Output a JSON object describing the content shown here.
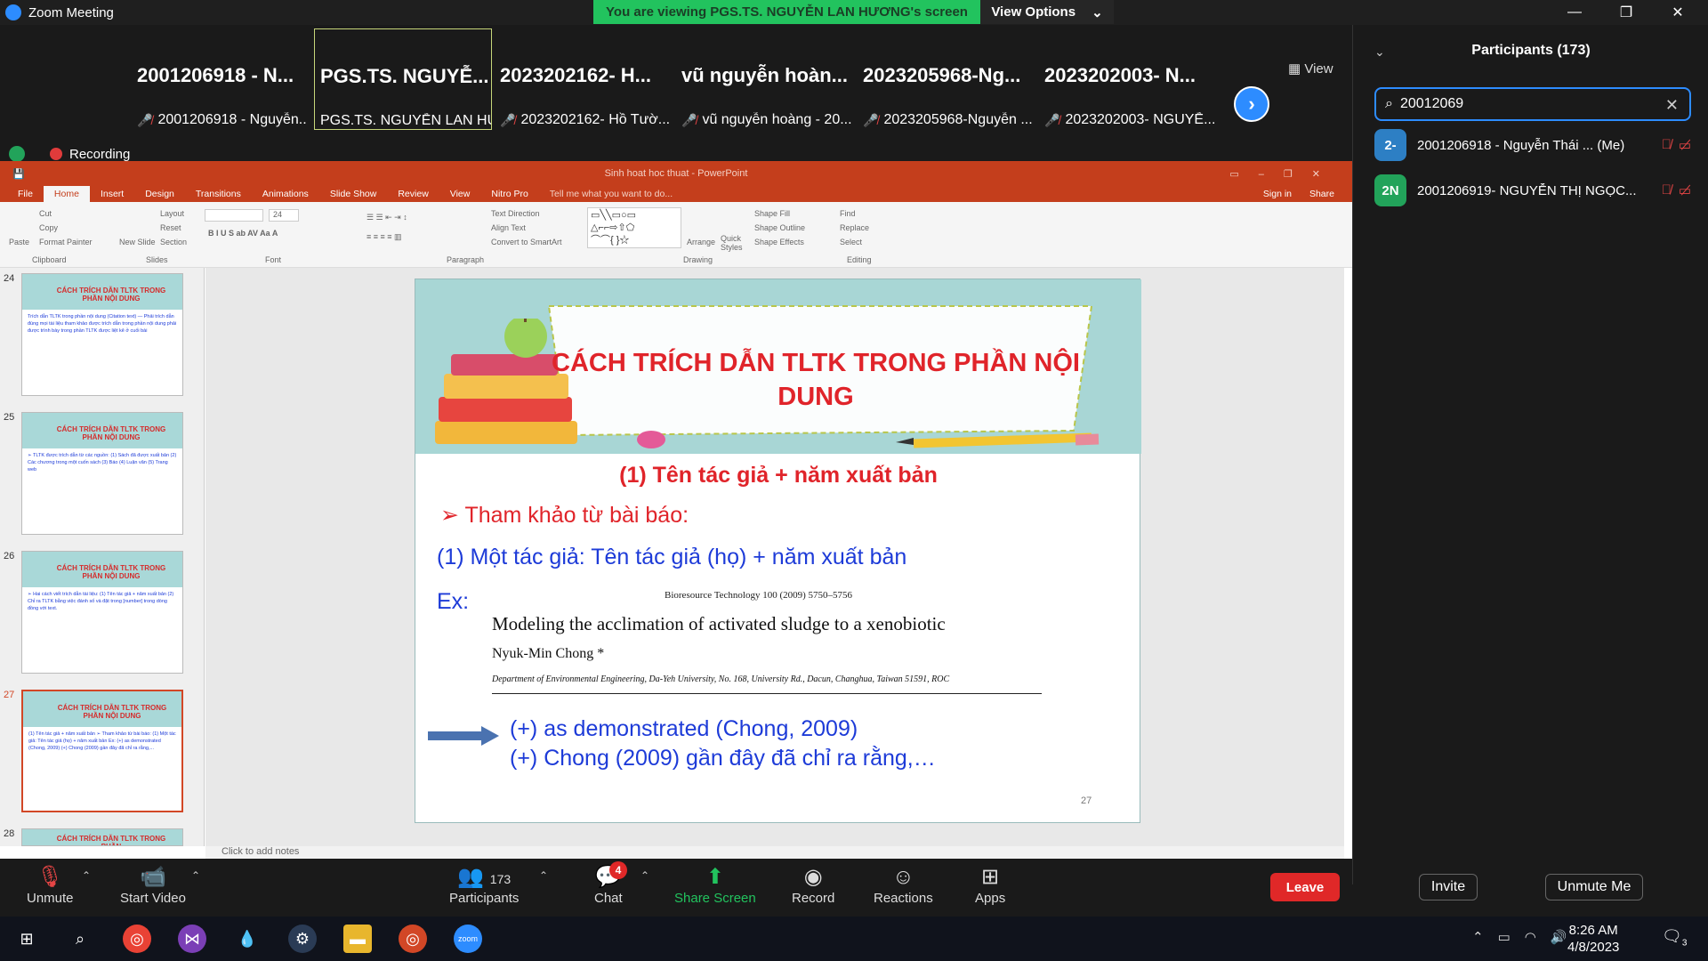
{
  "window": {
    "title": "Zoom Meeting",
    "banner": "You are viewing PGS.TS. NGUYỄN LAN HƯƠNG's screen",
    "view_options": "View Options",
    "view_button": "View"
  },
  "thumbnails": [
    {
      "big": "2001206918 - N...",
      "small": "2001206918 - Nguyễn..."
    },
    {
      "big": "PGS.TS. NGUYỄ...",
      "small": "PGS.TS. NGUYỄN LAN HƯ..."
    },
    {
      "big": "2023202162- H...",
      "small": "2023202162- Hồ Tườ..."
    },
    {
      "big": "vũ nguyễn hoàn...",
      "small": "vũ nguyễn hoàng - 20..."
    },
    {
      "big": "2023205968-Ng...",
      "small": "2023205968-Nguyễn ..."
    },
    {
      "big": "2023202003- N...",
      "small": "2023202003- NGUYỄ..."
    }
  ],
  "recording": "Recording",
  "ppt": {
    "doc_title": "Sinh hoat hoc thuat - PowerPoint",
    "tabs": [
      "File",
      "Home",
      "Insert",
      "Design",
      "Transitions",
      "Animations",
      "Slide Show",
      "Review",
      "View",
      "Nitro Pro",
      "Tell me what you want to do..."
    ],
    "signin": "Sign in",
    "share": "Share",
    "groups": {
      "clipboard": "Clipboard",
      "slides": "Slides",
      "font": "Font",
      "paragraph": "Paragraph",
      "drawing": "Drawing",
      "editing": "Editing"
    },
    "ribbon": {
      "paste": "Paste",
      "cut": "Cut",
      "copy": "Copy",
      "format_painter": "Format Painter",
      "new_slide": "New Slide",
      "layout": "Layout",
      "reset": "Reset",
      "section": "Section",
      "text_direction": "Text Direction",
      "align_text": "Align Text",
      "smartart": "Convert to SmartArt",
      "arrange": "Arrange",
      "quick_styles": "Quick Styles",
      "shape_fill": "Shape Fill",
      "shape_outline": "Shape Outline",
      "shape_effects": "Shape Effects",
      "find": "Find",
      "replace": "Replace",
      "select": "Select",
      "font_size": "24"
    },
    "thumbs": [
      {
        "num": "24",
        "title": "CÁCH TRÍCH DẪN TLTK TRONG PHẦN NỘI DUNG",
        "body": "Trích dẫn TLTK trong phần nội dung (Citation text) — Phải trích dẫn đúng mọi tài liệu tham khảo được trích dẫn trong phần nội dung phải được trình bày trong phần TLTK được liệt kê ở cuối bài"
      },
      {
        "num": "25",
        "title": "CÁCH TRÍCH DẪN TLTK TRONG PHẦN NỘI DUNG",
        "body": "➢ TLTK được trích dẫn từ các nguồn: (1) Sách đã được xuất bản (2) Các chương trong một cuốn sách (3) Báo (4) Luận văn (5) Trang web"
      },
      {
        "num": "26",
        "title": "CÁCH TRÍCH DẪN TLTK TRONG PHẦN NỘI DUNG",
        "body": "➢ Hai cách viết trích dẫn tài liệu: (1) Tên tác giả + năm xuất bản (2) Chỉ ra TLTK bằng việc đánh số và đặt trong [number] trong dòng đồng với text."
      },
      {
        "num": "27",
        "title": "CÁCH TRÍCH DẪN TLTK TRONG PHẦN NỘI DUNG",
        "body": "(1) Tên tác giả + năm xuất bản ➢ Tham khảo từ bài báo: (1) Một tác giả: Tên tác giả (họ) + năm xuất bản Ex: (+) as demonstrated (Chong, 2009) (+) Chong (2009) gần đây đã chỉ ra rằng,..."
      },
      {
        "num": "28",
        "title": "CÁCH TRÍCH DẪN TLTK TRONG PHẦN",
        "body": ""
      }
    ],
    "slide": {
      "title": "CÁCH TRÍCH DẪN TLTK TRONG PHẦN NỘI DUNG",
      "subtitle": "(1) Tên tác giả + năm xuất bản",
      "ref_head": "Tham khảo từ bài báo:",
      "one_author": "(1) Một tác giả: Tên tác giả (họ) + năm xuất bản",
      "ex": "Ex:",
      "journal": "Bioresource Technology 100 (2009) 5750–5756",
      "article": "Modeling the acclimation of activated sludge to a xenobiotic",
      "author": "Nyuk-Min Chong *",
      "affil": "Department of Environmental Engineering, Da-Yeh University, No. 168, University Rd., Dacun, Changhua, Taiwan 51591, ROC",
      "cite1": "(+) as demonstrated (Chong, 2009)",
      "cite2": "(+) Chong (2009) gần đây đã chỉ ra rằng,…",
      "page": "27"
    },
    "notes": "Click to add notes"
  },
  "participants": {
    "title": "Participants (173)",
    "search_value": "20012069",
    "list": [
      {
        "initials": "2-",
        "name": "2001206918 - Nguyễn Thái ... (Me)",
        "color": "#2d7fc4"
      },
      {
        "initials": "2N",
        "name": "2001206919- NGUYỄN THỊ NGỌC...",
        "color": "#22a35a"
      }
    ],
    "invite": "Invite",
    "unmute_me": "Unmute Me"
  },
  "toolbar": {
    "unmute": "Unmute",
    "start_video": "Start Video",
    "participants_count": "173",
    "participants": "Participants",
    "chat": "Chat",
    "chat_badge": "4",
    "share": "Share Screen",
    "record": "Record",
    "reactions": "Reactions",
    "apps": "Apps",
    "leave": "Leave"
  },
  "taskbar": {
    "time": "8:26 AM",
    "date": "4/8/2023",
    "notif_count": "3"
  }
}
